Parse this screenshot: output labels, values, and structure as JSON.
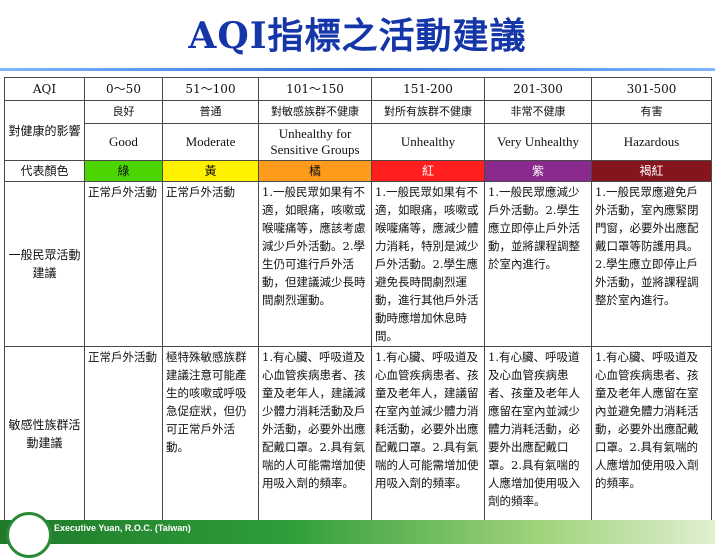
{
  "title": "AQI指標之活動建議",
  "footer": "Executive Yuan, R.O.C. (Taiwan)",
  "header": {
    "label": "AQI",
    "ranges": [
      "0～50",
      "51～100",
      "101～150",
      "151-200",
      "201-300",
      "301-500"
    ]
  },
  "health": {
    "label": "對健康的影響",
    "cn": [
      "良好",
      "普通",
      "對敏感族群不健康",
      "對所有族群不健康",
      "非常不健康",
      "有害"
    ],
    "en": [
      "Good",
      "Moderate",
      "Unhealthy for Sensitive Groups",
      "Unhealthy",
      "Very Unhealthy",
      "Hazardous"
    ]
  },
  "colors": {
    "label": "代表顏色",
    "names": [
      "綠",
      "黃",
      "橘",
      "紅",
      "紫",
      "褐紅"
    ],
    "hex": [
      "#4cd500",
      "#fff200",
      "#ff9b1a",
      "#ff1f1f",
      "#8a2a8c",
      "#86141c"
    ]
  },
  "general": {
    "label": "一般民眾活動建議",
    "advice": [
      "正常戶外活動",
      "正常戶外活動",
      "1.一般民眾如果有不適，如眼痛，咳嗽或喉嚨痛等，應該考慮減少戶外活動。2.學生仍可進行戶外活動，但建議減少長時間劇烈運動。",
      "1.一般民眾如果有不適，如眼痛，咳嗽或喉嚨痛等，應減少體力消耗，特別是減少戶外活動。2.學生應避免長時間劇烈運動，進行其他戶外活動時應增加休息時間。",
      "1.一般民眾應減少戶外活動。2.學生應立即停止戶外活動，並將課程調整於室內進行。",
      "1.一般民眾應避免戶外活動，室內應緊閉門窗，必要外出應配戴口罩等防護用具。2.學生應立即停止戶外活動，並將課程調整於室內進行。"
    ]
  },
  "sensitive": {
    "label": "敏感性族群活動建議",
    "advice": [
      "正常戶外活動",
      "極特殊敏感族群建議注意可能產生的咳嗽或呼吸急促症狀，但仍可正常戶外活動。",
      "1.有心臟、呼吸道及心血管疾病患者、孩童及老年人，建議減少體力消耗活動及戶外活動，必要外出應配戴口罩。2.具有氣喘的人可能需增加使用吸入劑的頻率。",
      "1.有心臟、呼吸道及心血管疾病患者、孩童及老年人，建議留在室內並減少體力消耗活動，必要外出應配戴口罩。2.具有氣喘的人可能需增加使用吸入劑的頻率。",
      "1.有心臟、呼吸道及心血管疾病患者、孩童及老年人應留在室內並減少體力消耗活動，必要外出應配戴口罩。2.具有氣喘的人應增加使用吸入劑的頻率。",
      "1.有心臟、呼吸道及心血管疾病患者、孩童及老年人應留在室內並避免體力消耗活動，必要外出應配戴口罩。2.具有氣喘的人應增加使用吸入劑的頻率。"
    ]
  }
}
